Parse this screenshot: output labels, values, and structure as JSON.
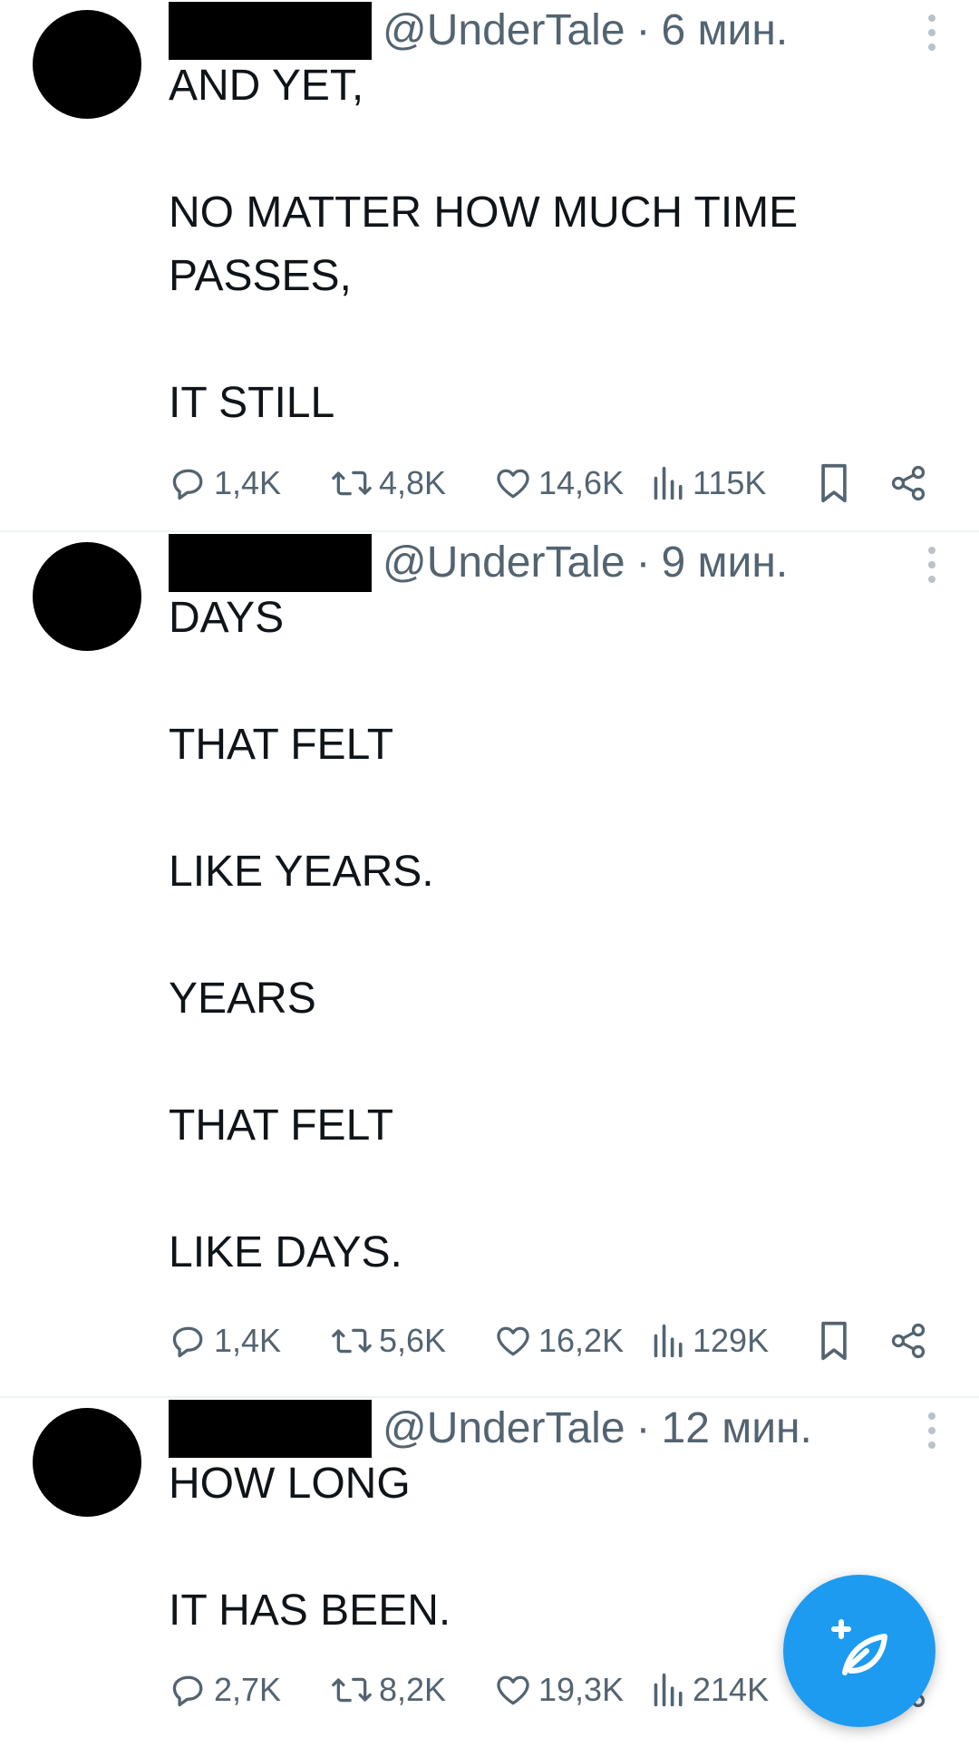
{
  "tweets": [
    {
      "handle": "@UnderTale",
      "separator": "·",
      "time": "6 мин.",
      "text": "AND YET,\n\nNO MATTER HOW MUCH TIME\nPASSES,\n\nIT STILL",
      "replies": "1,4K",
      "retweets": "4,8K",
      "likes": "14,6K",
      "views": "115K"
    },
    {
      "handle": "@UnderTale",
      "separator": "·",
      "time": "9 мин.",
      "text": "DAYS\n\nTHAT FELT\n\nLIKE YEARS.\n\nYEARS\n\nTHAT FELT\n\nLIKE DAYS.",
      "replies": "1,4K",
      "retweets": "5,6K",
      "likes": "16,2K",
      "views": "129K"
    },
    {
      "handle": "@UnderTale",
      "separator": "·",
      "time": "12 мин.",
      "text": "HOW LONG\n\nIT HAS BEEN.",
      "replies": "2,7K",
      "retweets": "8,2K",
      "likes": "19,3K",
      "views": "214K"
    }
  ],
  "icons": {
    "reply": "reply-icon",
    "retweet": "retweet-icon",
    "like": "heart-icon",
    "views": "views-icon",
    "bookmark": "bookmark-icon",
    "share": "share-icon",
    "more": "more-icon",
    "compose": "compose-icon"
  },
  "colors": {
    "accent": "#1d9bf0",
    "muted": "#536471",
    "text": "#0f1419",
    "divider": "#eff3f4"
  }
}
